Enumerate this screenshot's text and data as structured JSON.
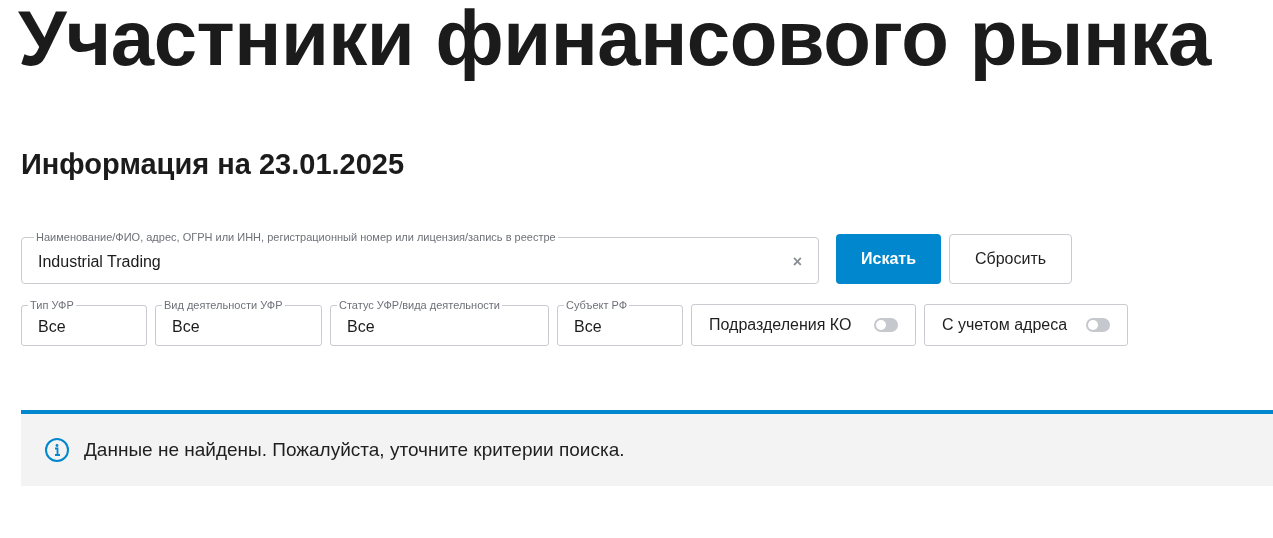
{
  "title": "Участники финансового рынка",
  "subtitle": "Информация на 23.01.2025",
  "search": {
    "label": "Наименование/ФИО, адрес, ОГРН или ИНН, регистрационный номер или лицензия/запись в реестре",
    "value": "Industrial Trading",
    "clear": "×"
  },
  "buttons": [
    {
      "label": "Искать",
      "kind": "primary"
    },
    {
      "label": "Сбросить",
      "kind": "secondary"
    }
  ],
  "filters": [
    {
      "label": "Тип УФР",
      "value": "Все"
    },
    {
      "label": "Вид деятельности УФР",
      "value": "Все"
    },
    {
      "label": "Статус УФР/вида деятельности",
      "value": "Все"
    },
    {
      "label": "Субъект РФ",
      "value": "Все"
    }
  ],
  "toggles": [
    {
      "label": "Подразделения КО",
      "on": false
    },
    {
      "label": "С учетом адреса",
      "on": false
    }
  ],
  "alert": {
    "message": "Данные не найдены. Пожалуйста, уточните критерии поиска."
  }
}
